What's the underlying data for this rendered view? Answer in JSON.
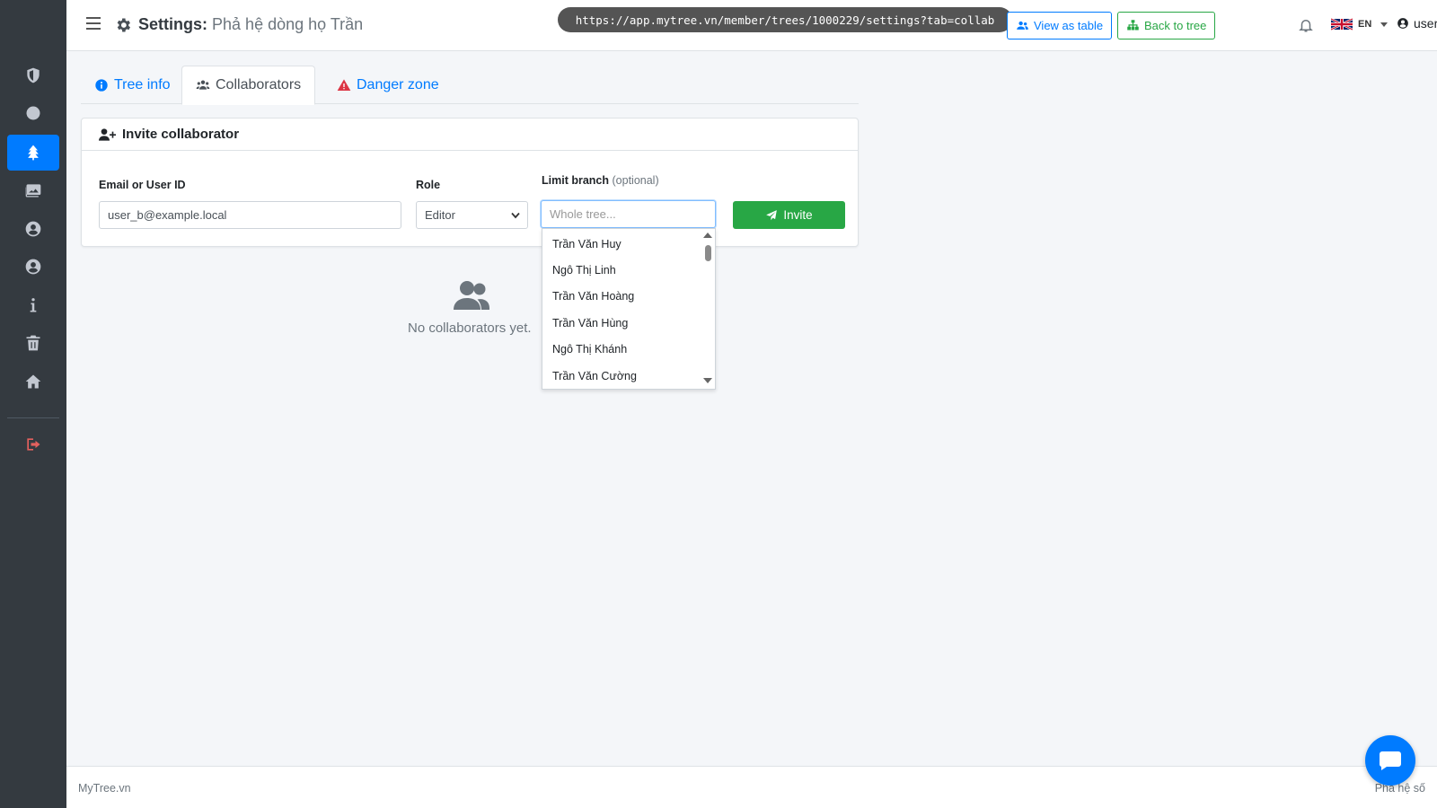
{
  "browser": {
    "url": "https://app.mytree.vn/member/trees/1000229/settings?tab=collab"
  },
  "header": {
    "title_prefix": "Settings:",
    "tree_name": "Phả hệ dòng họ Trần",
    "view_as_table": "View as table",
    "back_to_tree": "Back to tree",
    "language": "EN",
    "user": "user_a@exa..."
  },
  "sidebar": {
    "items": [
      {
        "name": "shield-icon"
      },
      {
        "name": "circle-icon"
      },
      {
        "name": "tree-icon",
        "active": true
      },
      {
        "name": "images-icon"
      },
      {
        "name": "user-circle-icon"
      },
      {
        "name": "user-circle-icon"
      },
      {
        "name": "info-icon"
      },
      {
        "name": "trash-icon"
      },
      {
        "name": "home-icon"
      },
      {
        "name": "logout-icon"
      }
    ]
  },
  "tabs": [
    {
      "label": "Tree info",
      "icon": "info-circle-icon"
    },
    {
      "label": "Collaborators",
      "icon": "users-icon",
      "active": true
    },
    {
      "label": "Danger zone",
      "icon": "warning-icon"
    }
  ],
  "invite": {
    "title": "Invite collaborator",
    "email_label": "Email or User ID",
    "email_value": "user_b@example.local",
    "role_label": "Role",
    "role_value": "Editor",
    "branch_label": "Limit branch",
    "branch_optional": "(optional)",
    "branch_placeholder": "Whole tree...",
    "invite_button": "Invite",
    "branch_options": [
      "Trần Văn Huy",
      "Ngô Thị Linh",
      "Trần Văn Hoàng",
      "Trần Văn Hùng",
      "Ngô Thị Khánh",
      "Trần Văn Cường"
    ]
  },
  "empty_state": {
    "text": "No collaborators yet."
  },
  "footer": {
    "left": "MyTree.vn",
    "right": "Phả hệ số"
  },
  "colors": {
    "primary": "#007bff",
    "success": "#28a745",
    "danger": "#dc3545",
    "sidebar": "#343a40"
  }
}
